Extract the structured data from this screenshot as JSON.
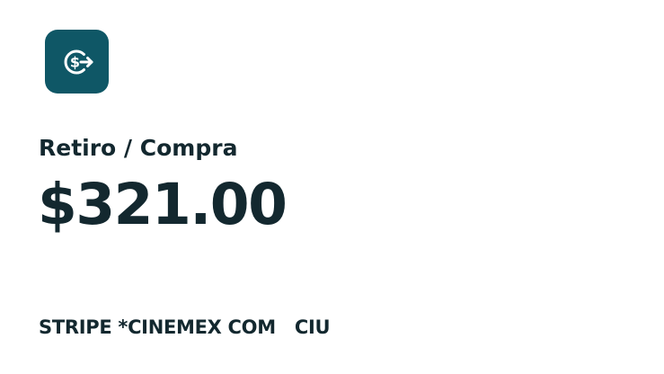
{
  "transaction": {
    "icon": "dollar-arrow-icon",
    "type_label": "Retiro / Compra",
    "amount": "$321.00",
    "merchant": "STRIPE *CINEMEX COM   CIU"
  },
  "colors": {
    "icon_background": "#0f5766",
    "text": "#13282f",
    "background": "#ffffff"
  }
}
